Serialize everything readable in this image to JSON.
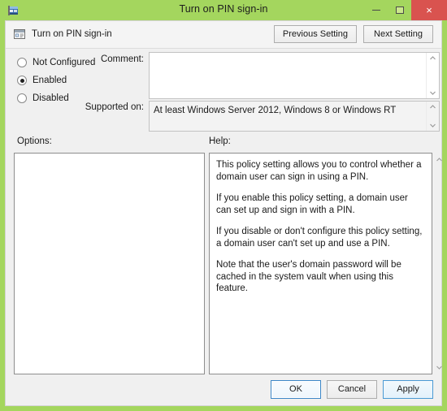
{
  "window": {
    "title": "Turn on PIN sign-in",
    "titlebar_icon": "group-policy-flag-icon",
    "accent_green": "#a4d65e",
    "close_red": "#d9534f",
    "controls": {
      "minimize_label": "Minimize",
      "maximize_label": "Maximize",
      "close_label": "×"
    }
  },
  "header": {
    "policy_name": "Turn on PIN sign-in",
    "policy_icon": "policy-setting-icon",
    "previous_setting_label": "Previous Setting",
    "next_setting_label": "Next Setting"
  },
  "state": {
    "options": [
      {
        "label": "Not Configured",
        "selected": false
      },
      {
        "label": "Enabled",
        "selected": true
      },
      {
        "label": "Disabled",
        "selected": false
      }
    ],
    "selected_option": "Enabled"
  },
  "fields": {
    "comment_label": "Comment:",
    "comment_value": "",
    "supported_label": "Supported on:",
    "supported_value": "At least Windows Server 2012, Windows 8 or Windows RT"
  },
  "panels": {
    "options_label": "Options:",
    "options_items": [],
    "help_label": "Help:",
    "help_paragraphs": [
      "This policy setting allows you to control whether a domain user can sign in using a PIN.",
      "If you enable this policy setting, a domain user can set up and sign in with a PIN.",
      "If you disable or don't configure this policy setting, a domain user can't set up and use a PIN.",
      "Note that the user's domain password will be cached in the system vault when using this feature."
    ]
  },
  "footer": {
    "ok_label": "OK",
    "cancel_label": "Cancel",
    "apply_label": "Apply"
  }
}
